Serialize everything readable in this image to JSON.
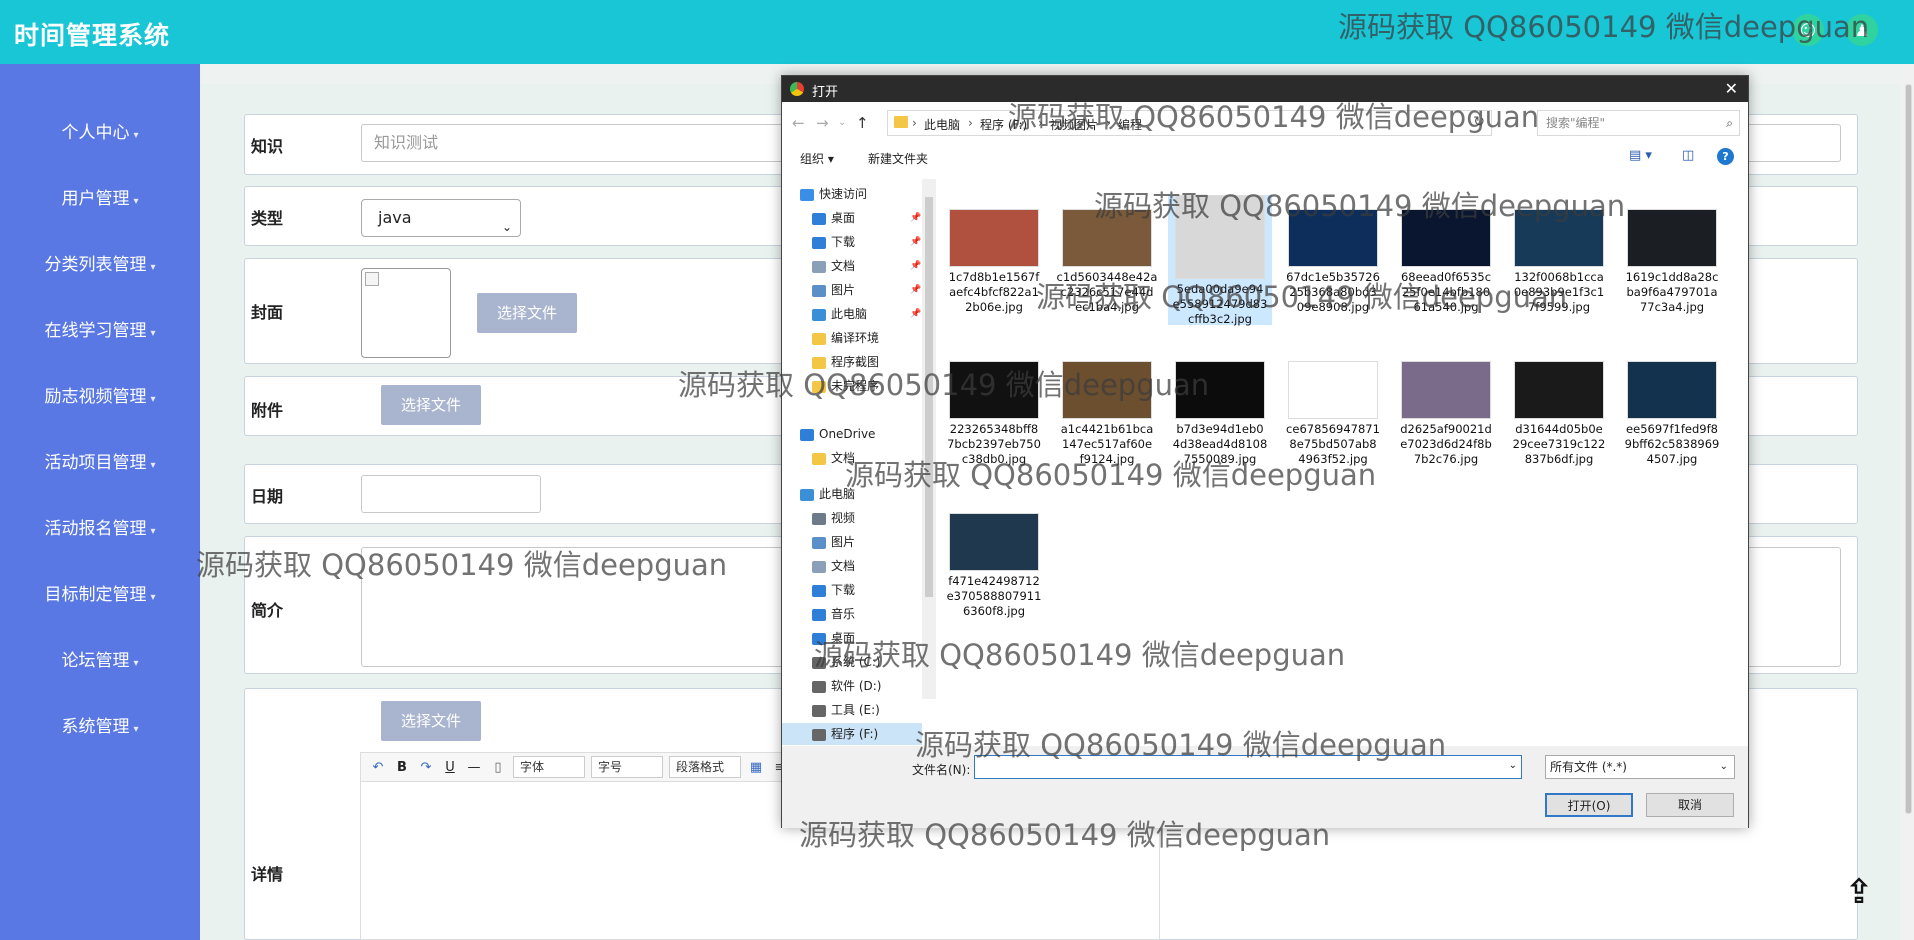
{
  "app": {
    "title": "时间管理系统"
  },
  "sidebar": {
    "items": [
      {
        "label": "个人中心"
      },
      {
        "label": "用户管理"
      },
      {
        "label": "分类列表管理"
      },
      {
        "label": "在线学习管理"
      },
      {
        "label": "励志视频管理"
      },
      {
        "label": "活动项目管理"
      },
      {
        "label": "活动报名管理"
      },
      {
        "label": "目标制定管理"
      },
      {
        "label": "论坛管理"
      },
      {
        "label": "系统管理"
      }
    ]
  },
  "form": {
    "knowledge_label": "知识",
    "knowledge_value": "知识测试",
    "type_label": "类型",
    "type_value": "java",
    "cover_label": "封面",
    "cover_button": "选择文件",
    "attachment_label": "附件",
    "attachment_button": "选择文件",
    "date_label": "日期",
    "date_value": "",
    "intro_label": "简介",
    "detail_label": "详情",
    "detail_button": "选择文件",
    "editor": {
      "font_select": "字体",
      "size_select": "字号",
      "para_select": "段落格式"
    }
  },
  "dialog": {
    "title": "打开",
    "breadcrumbs": [
      "此电脑",
      "程序 (F:)",
      "视频图片",
      "编程"
    ],
    "search_placeholder": "搜索\"编程\"",
    "organize_label": "组织",
    "new_folder_label": "新建文件夹",
    "nav_items": [
      {
        "label": "快速访问",
        "icon": "star-icon",
        "color": "#3a8ee6",
        "indent": 0
      },
      {
        "label": "桌面",
        "icon": "desktop-icon",
        "color": "#2f7fd8",
        "indent": 1,
        "pinned": true
      },
      {
        "label": "下载",
        "icon": "download-icon",
        "color": "#2f7fd8",
        "indent": 1,
        "pinned": true
      },
      {
        "label": "文档",
        "icon": "document-icon",
        "color": "#8aa0b8",
        "indent": 1,
        "pinned": true
      },
      {
        "label": "图片",
        "icon": "picture-icon",
        "color": "#5b8fc7",
        "indent": 1,
        "pinned": true
      },
      {
        "label": "此电脑",
        "icon": "computer-icon",
        "color": "#3b8fd6",
        "indent": 1,
        "pinned": true
      },
      {
        "label": "编译环境",
        "icon": "folder-icon",
        "color": "#f3c646",
        "indent": 1
      },
      {
        "label": "程序截图",
        "icon": "folder-icon",
        "color": "#f3c646",
        "indent": 1
      },
      {
        "label": "未完程序",
        "icon": "folder-icon",
        "color": "#f3c646",
        "indent": 1
      },
      {
        "label": "OneDrive",
        "icon": "cloud-icon",
        "color": "#2f7fd8",
        "indent": 0
      },
      {
        "label": "文档",
        "icon": "folder-icon",
        "color": "#f3c646",
        "indent": 1
      },
      {
        "label": "此电脑",
        "icon": "computer-icon",
        "color": "#3b8fd6",
        "indent": 0
      },
      {
        "label": "视频",
        "icon": "video-icon",
        "color": "#6c7a89",
        "indent": 1
      },
      {
        "label": "图片",
        "icon": "picture-icon",
        "color": "#5b8fc7",
        "indent": 1
      },
      {
        "label": "文档",
        "icon": "document-icon",
        "color": "#8aa0b8",
        "indent": 1
      },
      {
        "label": "下载",
        "icon": "download-icon",
        "color": "#2f7fd8",
        "indent": 1
      },
      {
        "label": "音乐",
        "icon": "music-icon",
        "color": "#2f7fd8",
        "indent": 1
      },
      {
        "label": "桌面",
        "icon": "desktop-icon",
        "color": "#2f7fd8",
        "indent": 1
      },
      {
        "label": "系统 (C:)",
        "icon": "drive-icon",
        "color": "#666666",
        "indent": 1
      },
      {
        "label": "软件 (D:)",
        "icon": "drive-icon",
        "color": "#666666",
        "indent": 1
      },
      {
        "label": "工具 (E:)",
        "icon": "drive-icon",
        "color": "#666666",
        "indent": 1
      },
      {
        "label": "程序 (F:)",
        "icon": "drive-icon",
        "color": "#666666",
        "indent": 1,
        "selected": true
      }
    ],
    "files": [
      {
        "name1": "1c7d8b1e1567f",
        "name2": "aefc4bfcf822a1",
        "name3": "2b06e.jpg",
        "color": "#b0503f"
      },
      {
        "name1": "c1d5603448e42a",
        "name2": "c2326c517e44d",
        "name3": "ec1ba4.jpg",
        "color": "#7a5a3a"
      },
      {
        "name1": "5eda00da9e94",
        "name2": "e558912479d83",
        "name3": "cffb3c2.jpg",
        "color": "#d8d8d8",
        "selected": true
      },
      {
        "name1": "67dc1e5b35726",
        "name2": "25b368a80bd3",
        "name3": "09e8908.jpg",
        "color": "#0d2d5a"
      },
      {
        "name1": "68eead0f6535c",
        "name2": "25f0e14bfb180",
        "name3": "61a540.jpg",
        "color": "#0a1630"
      },
      {
        "name1": "132f0068b1cca",
        "name2": "0e893b9e1f3c1",
        "name3": "7f9599.jpg",
        "color": "#163a57"
      },
      {
        "name1": "1619c1dd8a28c",
        "name2": "ba9f6a479701a",
        "name3": "77c3a4.jpg",
        "color": "#1b1f24"
      },
      {
        "name1": "223265348bff8",
        "name2": "7bcb2397eb750",
        "name3": "c38db0.jpg",
        "color": "#111111"
      },
      {
        "name1": "a1c4421b61bca",
        "name2": "147ec517af60e",
        "name3": "f9124.jpg",
        "color": "#6b4f2f"
      },
      {
        "name1": "b7d3e94d1eb0",
        "name2": "4d38ead4d8108",
        "name3": "7550089.jpg",
        "color": "#0c0c0c"
      },
      {
        "name1": "ce67856947871",
        "name2": "8e75bd507ab8",
        "name3": "4963f52.jpg",
        "color": "#ffffff"
      },
      {
        "name1": "d2625af90021d",
        "name2": "e7023d6d24f8b",
        "name3": "7b2c76.jpg",
        "color": "#7a6b8a"
      },
      {
        "name1": "d31644d05b0e",
        "name2": "29cee7319c122",
        "name3": "837b6df.jpg",
        "color": "#1a1a1a"
      },
      {
        "name1": "ee5697f1fed9f8",
        "name2": "9bff62c5838969",
        "name3": "4507.jpg",
        "color": "#12324e"
      },
      {
        "name1": "f471e42498712",
        "name2": "e370588807911",
        "name3": "6360f8.jpg",
        "color": "#20384e"
      }
    ],
    "filename_label": "文件名(N):",
    "filetype_value": "所有文件 (*.*)",
    "open_button": "打开(O)",
    "cancel_button": "取消"
  },
  "watermark": "源码获取 QQ86050149 微信deepguan"
}
